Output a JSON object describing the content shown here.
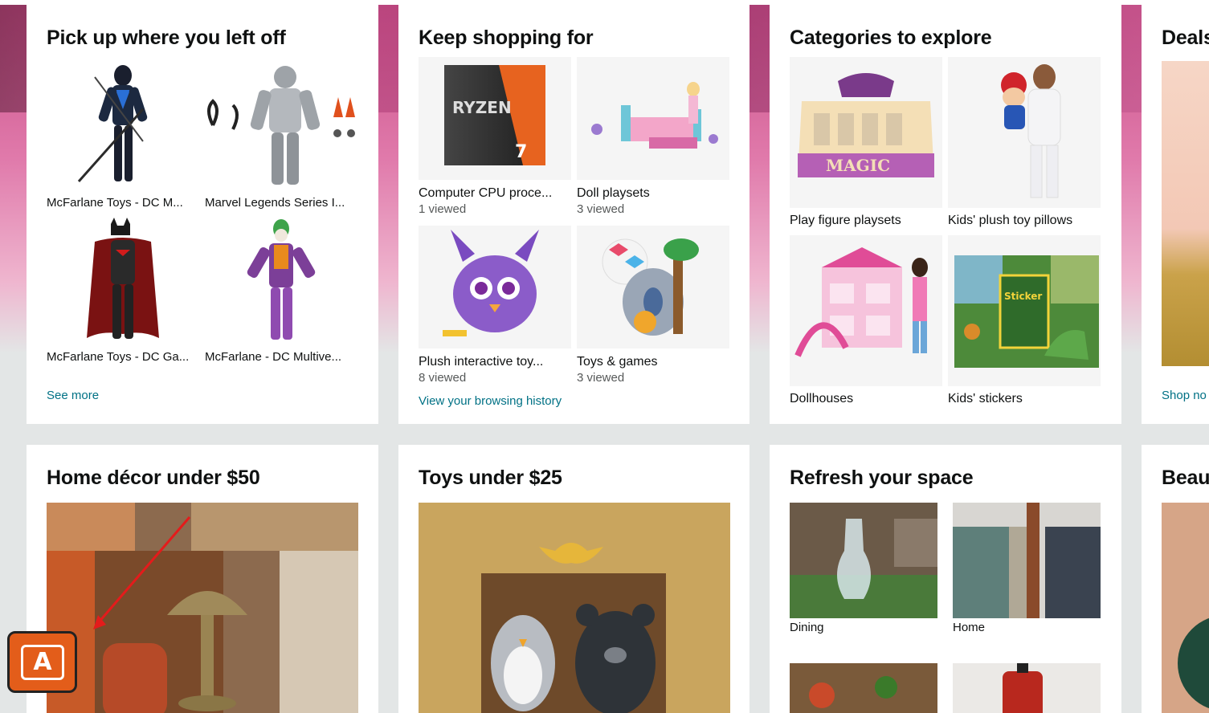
{
  "cards": {
    "pickup": {
      "title": "Pick up where you left off",
      "items": [
        {
          "label": "McFarlane Toys - DC M..."
        },
        {
          "label": "Marvel Legends Series I..."
        },
        {
          "label": "McFarlane Toys - DC Ga..."
        },
        {
          "label": "McFarlane - DC Multive..."
        }
      ],
      "link": "See more"
    },
    "keep": {
      "title": "Keep shopping for",
      "items": [
        {
          "label": "Computer CPU proce...",
          "sub": "1 viewed"
        },
        {
          "label": "Doll playsets",
          "sub": "3 viewed"
        },
        {
          "label": "Plush interactive toy...",
          "sub": "8 viewed"
        },
        {
          "label": "Toys & games",
          "sub": "3 viewed"
        }
      ],
      "link": "View your browsing history"
    },
    "categories": {
      "title": "Categories to explore",
      "items": [
        {
          "label": "Play figure playsets"
        },
        {
          "label": "Kids' plush toy pillows"
        },
        {
          "label": "Dollhouses"
        },
        {
          "label": "Kids' stickers"
        }
      ]
    },
    "deals": {
      "title": "Deals",
      "link": "Shop no"
    },
    "homedecor": {
      "title": "Home décor under $50"
    },
    "toys25": {
      "title": "Toys under $25"
    },
    "refresh": {
      "title": "Refresh your space",
      "items": [
        {
          "label": "Dining"
        },
        {
          "label": "Home"
        }
      ]
    },
    "beauty": {
      "title": "Beau"
    }
  },
  "extension": {
    "glyph": "A"
  },
  "colors": {
    "link": "#007185",
    "background": "#e3e6e6",
    "extension": "#e35d1a"
  }
}
